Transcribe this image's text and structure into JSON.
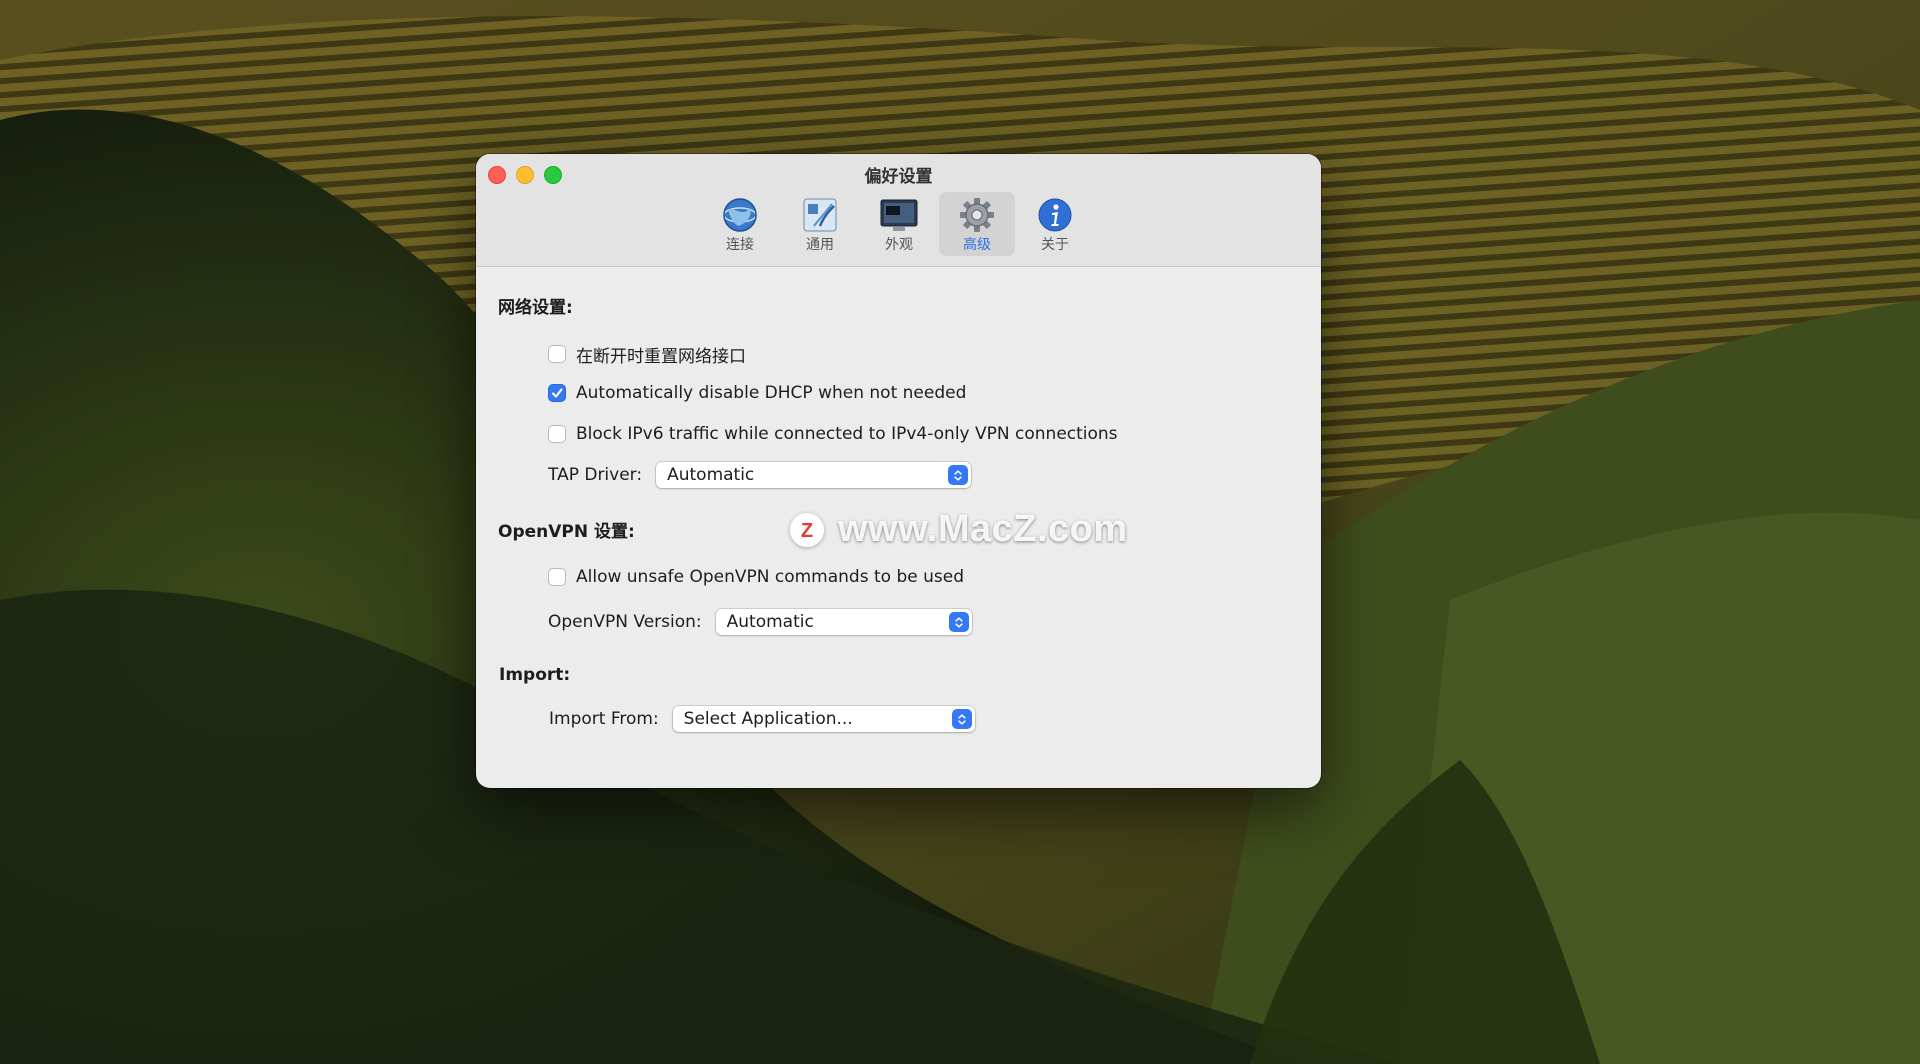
{
  "window": {
    "title": "偏好设置"
  },
  "toolbar": {
    "items": [
      {
        "label": "连接",
        "icon": "globe-icon",
        "active": false
      },
      {
        "label": "通用",
        "icon": "network-config-icon",
        "active": false
      },
      {
        "label": "外观",
        "icon": "monitor-icon",
        "active": false
      },
      {
        "label": "高级",
        "icon": "gear-icon",
        "active": true
      },
      {
        "label": "关于",
        "icon": "info-icon",
        "active": false
      }
    ]
  },
  "network": {
    "title": "网络设置:",
    "reset_interface": {
      "label": "在断开时重置网络接口",
      "checked": false
    },
    "disable_dhcp": {
      "label": "Automatically disable DHCP when not needed",
      "checked": true
    },
    "block_ipv6": {
      "label": "Block IPv6 traffic while connected to IPv4-only VPN connections",
      "checked": false
    },
    "tap_driver": {
      "label": "TAP Driver:",
      "value": "Automatic"
    }
  },
  "openvpn": {
    "title": "OpenVPN 设置:",
    "unsafe_commands": {
      "label": "Allow unsafe OpenVPN commands to be used",
      "checked": false
    },
    "version": {
      "label": "OpenVPN Version:",
      "value": "Automatic"
    }
  },
  "import": {
    "title": "Import:",
    "from": {
      "label": "Import From:",
      "value": "Select Application..."
    }
  },
  "watermark": {
    "text": "www.MacZ.com",
    "logo_letter": "Z"
  },
  "colors": {
    "accent": "#3478f6",
    "close": "#fe5f57",
    "minimize": "#febc2e",
    "zoom": "#28c840"
  }
}
